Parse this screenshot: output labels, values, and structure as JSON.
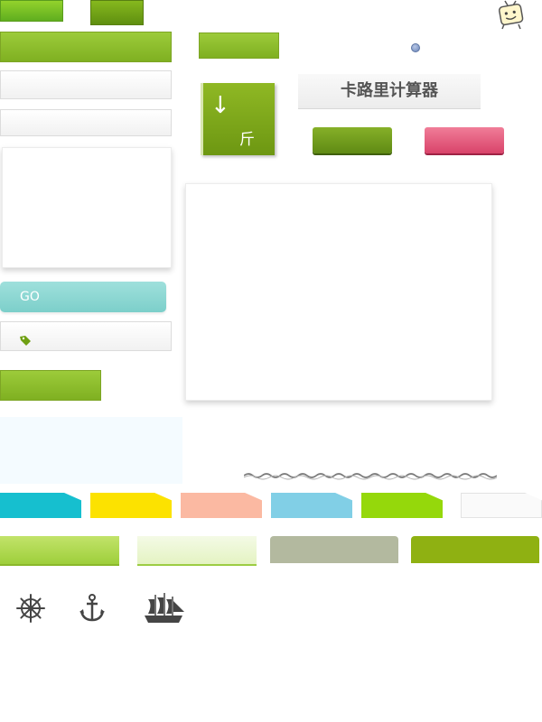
{
  "calculator": {
    "title": "卡路里计算器",
    "unit_label": "斤",
    "unit_arrow": "↓",
    "go_label": "GO"
  },
  "colors": {
    "green_accent": "#8fb112",
    "pink_button": "#e05678",
    "teal_button": "#8cd8d3",
    "tag_teal": "#16bfcf",
    "tag_yellow": "#fce200",
    "tag_salmon": "#fbb9a2",
    "tag_skyblue": "#81cfe6",
    "tag_lime": "#95d80b",
    "light_blue_panel": "#f4fbff"
  },
  "icons": {
    "mascot": "tv-mascot-icon",
    "info_dot": "small-dot-icon",
    "tag": "price-tag-icon",
    "helm": "ship-wheel-icon",
    "anchor": "anchor-icon",
    "ship": "sailing-ship-icon"
  }
}
